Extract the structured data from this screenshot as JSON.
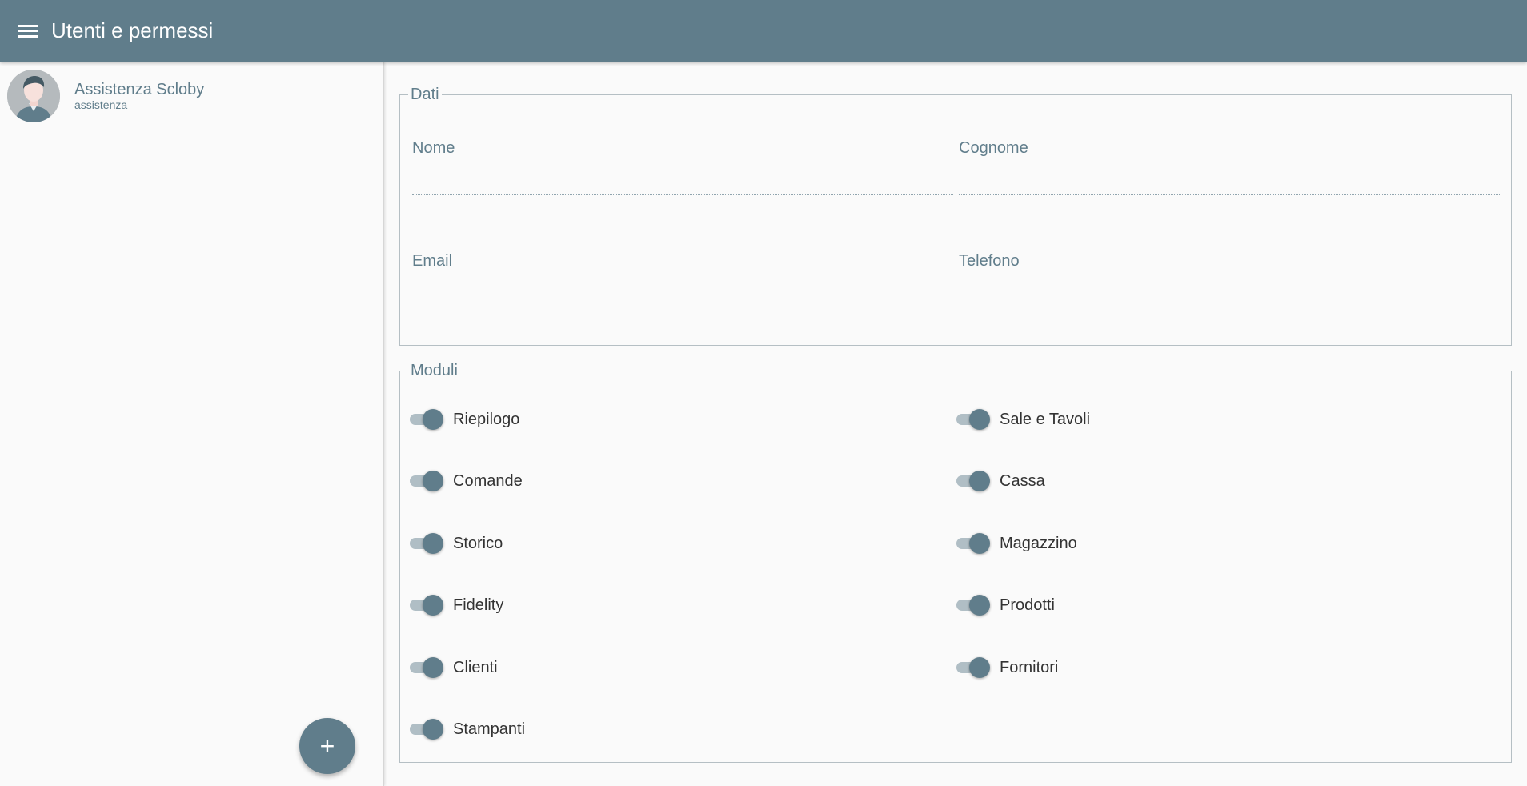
{
  "header": {
    "title": "Utenti e permessi",
    "menu_icon": "menu-icon"
  },
  "sidebar": {
    "users": [
      {
        "name": "Assistenza Scloby",
        "username": "assistenza",
        "avatar_icon": "user-avatar-icon"
      }
    ],
    "add_button_symbol": "+"
  },
  "form": {
    "dati": {
      "legend": "Dati",
      "nome": {
        "label": "Nome",
        "value": ""
      },
      "cognome": {
        "label": "Cognome",
        "value": ""
      },
      "email": {
        "label": "Email",
        "value": ""
      },
      "telefono": {
        "label": "Telefono",
        "value": ""
      }
    },
    "moduli": {
      "legend": "Moduli",
      "items": [
        {
          "label": "Riepilogo",
          "enabled": true
        },
        {
          "label": "Sale e Tavoli",
          "enabled": true
        },
        {
          "label": "Comande",
          "enabled": true
        },
        {
          "label": "Cassa",
          "enabled": true
        },
        {
          "label": "Storico",
          "enabled": true
        },
        {
          "label": "Magazzino",
          "enabled": true
        },
        {
          "label": "Fidelity",
          "enabled": true
        },
        {
          "label": "Prodotti",
          "enabled": true
        },
        {
          "label": "Clienti",
          "enabled": true
        },
        {
          "label": "Fornitori",
          "enabled": true
        },
        {
          "label": "Stampanti",
          "enabled": true
        }
      ]
    }
  },
  "colors": {
    "primary": "#607d8b",
    "track": "#b0bec5",
    "background": "#fafafa"
  }
}
